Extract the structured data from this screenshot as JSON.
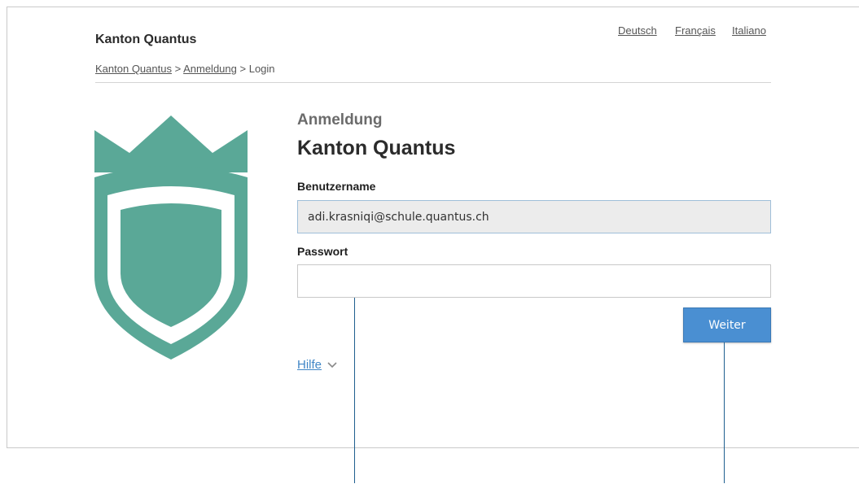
{
  "header": {
    "brand": "Kanton Quantus",
    "languages": [
      "Deutsch",
      "Français",
      "Italiano"
    ]
  },
  "breadcrumb": {
    "items": [
      "Kanton Quantus",
      "Anmeldung",
      "Login"
    ],
    "separator": ">"
  },
  "logo": {
    "icon": "shield-crown-icon",
    "color": "#5aa897"
  },
  "form": {
    "subtitle": "Anmeldung",
    "title": "Kanton Quantus",
    "username_label": "Benutzername",
    "username_value": "adi.krasniqi@schule.quantus.ch",
    "password_label": "Passwort",
    "password_value": "",
    "submit_label": "Weiter",
    "help_label": "Hilfe"
  },
  "colors": {
    "accent": "#4a8fd2",
    "link": "#3f86c6",
    "logo": "#5aa897",
    "callout": "#1f5f8f"
  }
}
